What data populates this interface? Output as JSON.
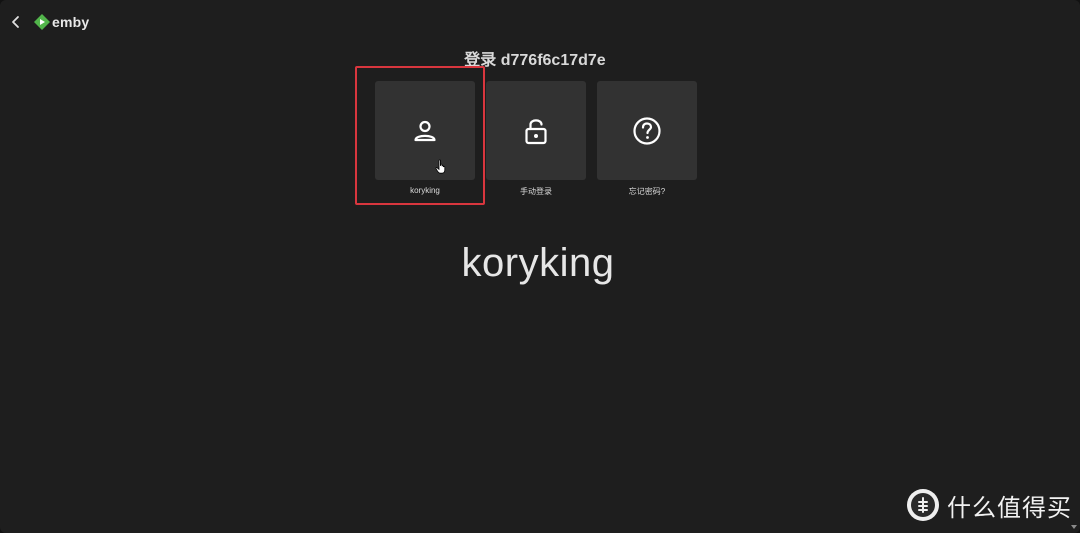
{
  "app": {
    "brand": "emby",
    "colors": {
      "background": "#1e1e1e",
      "tile": "#323232",
      "brand_green": "#52b54b",
      "highlight": "#d9363e"
    }
  },
  "topbar": {
    "back_icon": "chevron-left-icon",
    "logo_icon": "emby-logo-icon"
  },
  "page": {
    "title": "登录 d776f6c17d7e"
  },
  "tiles": [
    {
      "label": "koryking",
      "icon": "user-icon",
      "highlighted": true
    },
    {
      "label": "手动登录",
      "icon": "lock-icon",
      "highlighted": false
    },
    {
      "label": "忘记密码?",
      "icon": "help-circle-icon",
      "highlighted": false
    }
  ],
  "selected_user": {
    "name": "koryking"
  },
  "watermark": {
    "text": "什么值得买",
    "badge_glyph": "值"
  }
}
